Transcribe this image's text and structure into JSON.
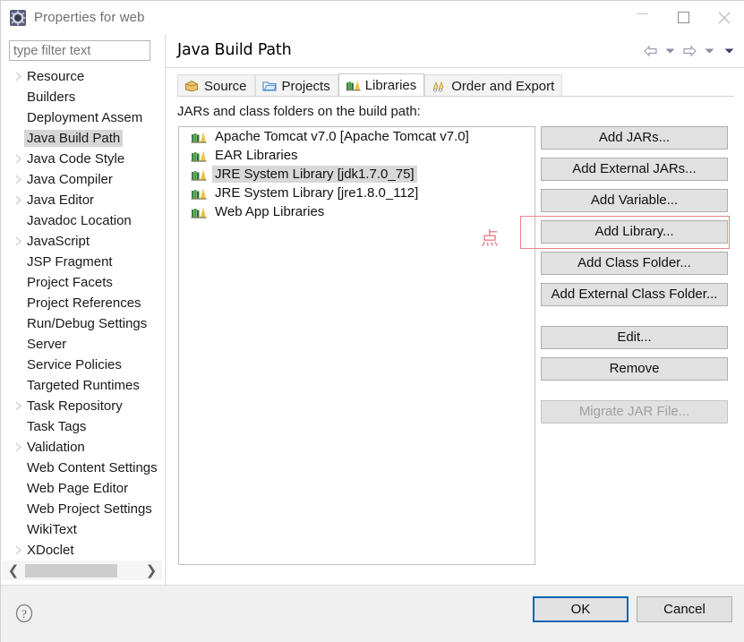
{
  "window": {
    "title": "Properties for web",
    "icon": "properties-gear-icon",
    "controls": {
      "minimize": "minimize-icon",
      "maximize": "maximize-icon",
      "close": "close-icon"
    }
  },
  "sidebar": {
    "filter": {
      "placeholder": "type filter text",
      "value": ""
    },
    "items": [
      {
        "label": "Resource",
        "expandable": true,
        "selected": false
      },
      {
        "label": "Builders",
        "expandable": false,
        "selected": false
      },
      {
        "label": "Deployment Assem",
        "expandable": false,
        "selected": false
      },
      {
        "label": "Java Build Path",
        "expandable": false,
        "selected": true
      },
      {
        "label": "Java Code Style",
        "expandable": true,
        "selected": false
      },
      {
        "label": "Java Compiler",
        "expandable": true,
        "selected": false
      },
      {
        "label": "Java Editor",
        "expandable": true,
        "selected": false
      },
      {
        "label": "Javadoc Location",
        "expandable": false,
        "selected": false
      },
      {
        "label": "JavaScript",
        "expandable": true,
        "selected": false
      },
      {
        "label": "JSP Fragment",
        "expandable": false,
        "selected": false
      },
      {
        "label": "Project Facets",
        "expandable": false,
        "selected": false
      },
      {
        "label": "Project References",
        "expandable": false,
        "selected": false
      },
      {
        "label": "Run/Debug Settings",
        "expandable": false,
        "selected": false
      },
      {
        "label": "Server",
        "expandable": false,
        "selected": false
      },
      {
        "label": "Service Policies",
        "expandable": false,
        "selected": false
      },
      {
        "label": "Targeted Runtimes",
        "expandable": false,
        "selected": false
      },
      {
        "label": "Task Repository",
        "expandable": true,
        "selected": false
      },
      {
        "label": "Task Tags",
        "expandable": false,
        "selected": false
      },
      {
        "label": "Validation",
        "expandable": true,
        "selected": false
      },
      {
        "label": "Web Content Settings",
        "expandable": false,
        "selected": false
      },
      {
        "label": "Web Page Editor",
        "expandable": false,
        "selected": false
      },
      {
        "label": "Web Project Settings",
        "expandable": false,
        "selected": false
      },
      {
        "label": "WikiText",
        "expandable": false,
        "selected": false
      },
      {
        "label": "XDoclet",
        "expandable": true,
        "selected": false
      }
    ],
    "scrollbar": {
      "left_arrow": "chevron-left-icon",
      "right_arrow": "chevron-right-icon"
    }
  },
  "content": {
    "page_title": "Java Build Path",
    "nav": [
      {
        "name": "back-arrow-icon"
      },
      {
        "name": "back-dropdown-icon"
      },
      {
        "name": "forward-arrow-icon"
      },
      {
        "name": "forward-dropdown-icon"
      },
      {
        "name": "view-menu-icon"
      }
    ],
    "tabs": [
      {
        "label": "Source",
        "icon": "source-package-icon",
        "active": false
      },
      {
        "label": "Projects",
        "icon": "projects-folder-icon",
        "active": false
      },
      {
        "label": "Libraries",
        "icon": "libraries-books-icon",
        "active": true
      },
      {
        "label": "Order and Export",
        "icon": "order-export-icon",
        "active": false
      }
    ],
    "section_label": "JARs and class folders on the build path:",
    "libraries": [
      {
        "label": "Apache Tomcat v7.0 [Apache Tomcat v7.0]",
        "icon": "library-books-icon",
        "selected": false
      },
      {
        "label": "EAR Libraries",
        "icon": "library-books-icon",
        "selected": false
      },
      {
        "label": "JRE System Library [jdk1.7.0_75]",
        "icon": "library-books-icon",
        "selected": true
      },
      {
        "label": "JRE System Library [jre1.8.0_112]",
        "icon": "library-books-icon",
        "selected": false
      },
      {
        "label": "Web App Libraries",
        "icon": "library-books-icon",
        "selected": false
      }
    ],
    "buttons": [
      {
        "label": "Add JARs...",
        "disabled": false,
        "highlighted": false
      },
      {
        "label": "Add External JARs...",
        "disabled": false,
        "highlighted": false
      },
      {
        "label": "Add Variable...",
        "disabled": false,
        "highlighted": false
      },
      {
        "label": "Add Library...",
        "disabled": false,
        "highlighted": true
      },
      {
        "label": "Add Class Folder...",
        "disabled": false,
        "highlighted": false
      },
      {
        "label": "Add External Class Folder...",
        "disabled": false,
        "highlighted": false
      },
      {
        "label": "Edit...",
        "disabled": false,
        "highlighted": false
      },
      {
        "label": "Remove",
        "disabled": false,
        "highlighted": false
      },
      {
        "label": "Migrate JAR File...",
        "disabled": true,
        "highlighted": false
      }
    ]
  },
  "annotation": {
    "marker_text": "点",
    "color": "#e8868d"
  },
  "footer": {
    "help_icon": "help-question-icon",
    "ok_label": "OK",
    "cancel_label": "Cancel",
    "focus_color": "#0a64ad"
  }
}
